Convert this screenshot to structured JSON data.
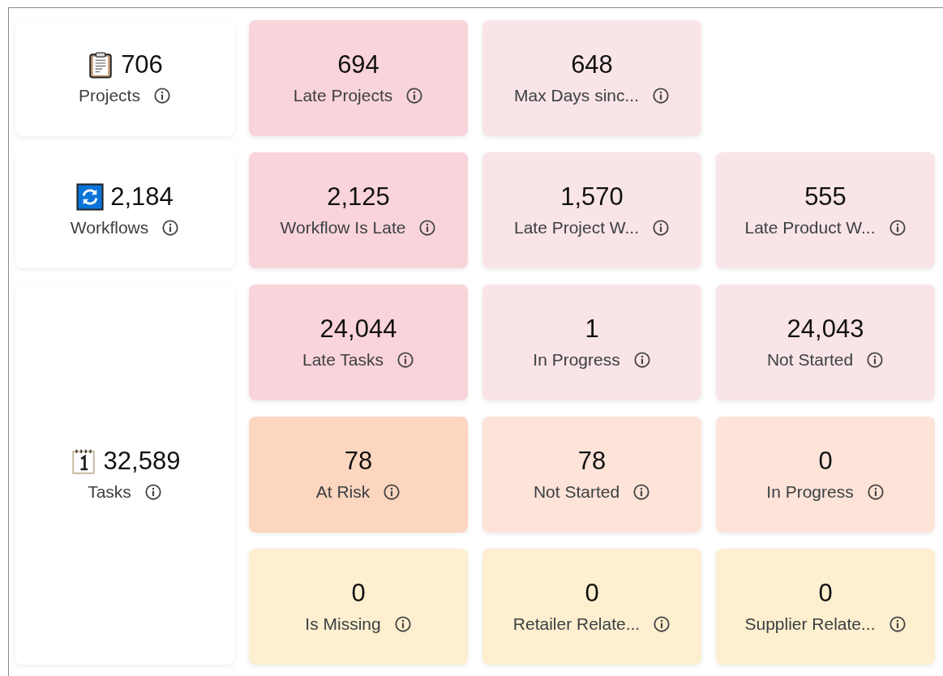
{
  "groups": [
    {
      "kind": "clipboard",
      "value": "706",
      "label": "Projects",
      "rows": [
        [
          {
            "value": "694",
            "label": "Late Projects",
            "color": "#fad4db"
          },
          {
            "value": "648",
            "label": "Max Days sinc...",
            "color": "#f9e4e7"
          }
        ]
      ]
    },
    {
      "kind": "sync",
      "value": "2,184",
      "label": "Workflows",
      "rows": [
        [
          {
            "value": "2,125",
            "label": "Workflow Is Late",
            "color": "#fad4db"
          },
          {
            "value": "1,570",
            "label": "Late Project W...",
            "color": "#f9e4e7"
          },
          {
            "value": "555",
            "label": "Late Product W...",
            "color": "#f9e4e7"
          }
        ]
      ]
    },
    {
      "kind": "calendar",
      "value": "32,589",
      "label": "Tasks",
      "rows": [
        [
          {
            "value": "24,044",
            "label": "Late Tasks",
            "color": "#fad4db"
          },
          {
            "value": "1",
            "label": "In Progress",
            "color": "#f9e4e7"
          },
          {
            "value": "24,043",
            "label": "Not Started",
            "color": "#f9e4e7"
          }
        ],
        [
          {
            "value": "78",
            "label": "At Risk",
            "color": "#fdd6bf"
          },
          {
            "value": "78",
            "label": "Not Started",
            "color": "#fde3d8"
          },
          {
            "value": "0",
            "label": "In Progress",
            "color": "#fde3d8"
          }
        ],
        [
          {
            "value": "0",
            "label": "Is Missing",
            "color": "#fdefcf"
          },
          {
            "value": "0",
            "label": "Retailer Relate...",
            "color": "#fdefcf"
          },
          {
            "value": "0",
            "label": "Supplier Relate...",
            "color": "#fdefcf"
          }
        ]
      ]
    }
  ]
}
